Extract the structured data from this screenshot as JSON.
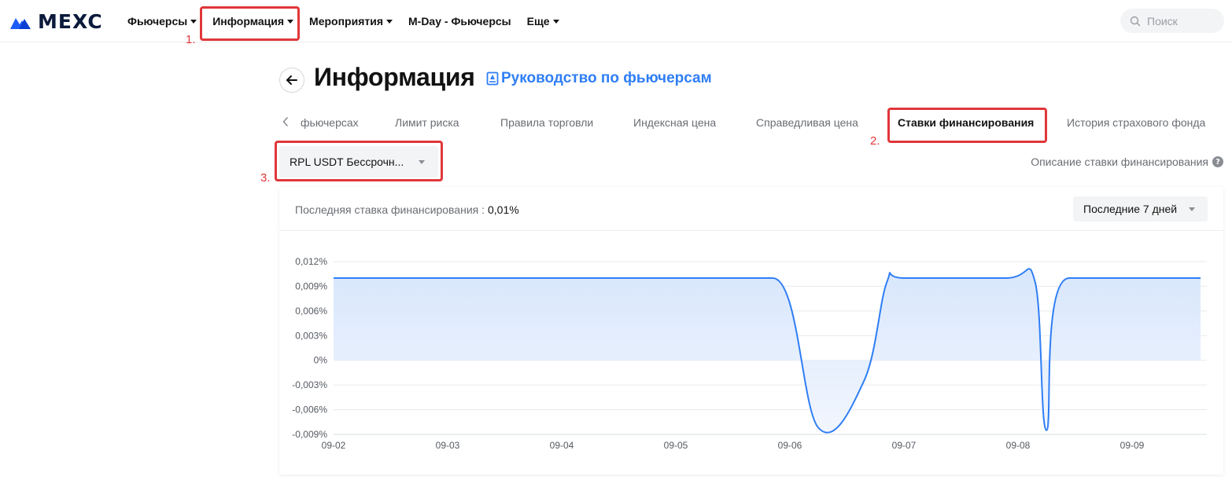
{
  "header": {
    "logo_text": "MEXC",
    "nav": [
      {
        "label": "Фьючерсы",
        "caret": true
      },
      {
        "label": "Информация",
        "caret": true
      },
      {
        "label": "Мероприятия",
        "caret": true
      },
      {
        "label": "M-Day - Фьючерсы",
        "caret": false
      },
      {
        "label": "Еще",
        "caret": true
      }
    ],
    "search_placeholder": "Поиск"
  },
  "annotations": [
    "1.",
    "2.",
    "3."
  ],
  "page": {
    "title": "Информация",
    "guide_link": "Руководство по фьючерсам"
  },
  "tabs": [
    {
      "label": "фьючерсах",
      "active": false
    },
    {
      "label": "Лимит риска",
      "active": false
    },
    {
      "label": "Правила торговли",
      "active": false
    },
    {
      "label": "Индексная цена",
      "active": false
    },
    {
      "label": "Справедливая цена",
      "active": false
    },
    {
      "label": "Ставки финансирования",
      "active": true
    },
    {
      "label": "История страхового фонда",
      "active": false
    }
  ],
  "symbol_select": {
    "value": "RPL USDT Бессрочн..."
  },
  "funding_description": "Описание ставки финансирования",
  "card": {
    "last_rate_label": "Последняя ставка финансирования :",
    "last_rate_value": "0,01%",
    "period_select": "Последние 7 дней"
  },
  "chart_data": {
    "type": "area",
    "x": [
      "09-02",
      "09-03",
      "09-04",
      "09-05",
      "09-06",
      "09-06",
      "09-07",
      "09-07",
      "09-08",
      "09-08",
      "09-09",
      "09-09"
    ],
    "x_decimal_days": [
      2.0,
      5.0,
      5.85,
      6.25,
      6.65,
      6.85,
      7.0,
      7.9,
      8.15,
      8.25,
      8.45,
      9.6
    ],
    "y_series_percent": [
      0.01,
      0.01,
      0.01,
      -0.0082,
      -0.0025,
      0.0095,
      0.01,
      0.01,
      0.0095,
      -0.0085,
      0.01,
      0.01
    ],
    "series": [
      {
        "name": "",
        "values": [
          0.01,
          0.01,
          0.01,
          -0.0082,
          -0.0025,
          0.0095,
          0.01,
          0.01,
          0.0095,
          -0.0085,
          0.01,
          0.01
        ]
      }
    ],
    "x_ticks": [
      "09-02",
      "09-03",
      "09-04",
      "09-05",
      "09-06",
      "09-07",
      "09-08",
      "09-09"
    ],
    "y_ticks": [
      "0,012%",
      "0,009%",
      "0,006%",
      "0,003%",
      "0%",
      "-0,003%",
      "-0,006%",
      "-0,009%"
    ],
    "ylim": [
      -0.009,
      0.012
    ],
    "grid": true,
    "colors": {
      "line": "#2f7ef5",
      "fill": "#e6f0fd"
    }
  }
}
